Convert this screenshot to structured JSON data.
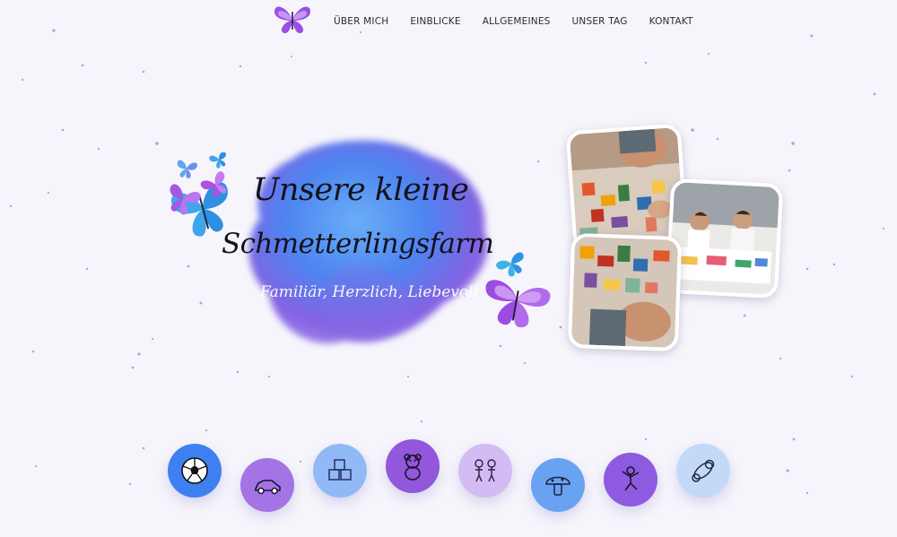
{
  "nav": {
    "logo_icon": "butterfly-logo-icon",
    "links": [
      {
        "label": "ÜBER MICH"
      },
      {
        "label": "EINBLICKE"
      },
      {
        "label": "ALLGEMEINES"
      },
      {
        "label": "UNSER TAG"
      },
      {
        "label": "KONTAKT"
      }
    ]
  },
  "hero": {
    "title_line1": "Unsere kleine",
    "title_line2": "Schmetterlingsfarm",
    "tagline": "Familiär, Herzlich, Liebevoll"
  },
  "photos": [
    {
      "icon": "children-playing-blocks-photo"
    },
    {
      "icon": "two-boys-at-table-photo"
    },
    {
      "icon": "building-blocks-photo"
    }
  ],
  "feature_circles": [
    {
      "icon": "soccer-ball-icon",
      "color": "#3f80f0"
    },
    {
      "icon": "toy-car-icon",
      "color": "#a474e6"
    },
    {
      "icon": "toy-blocks-icon",
      "color": "#90b9f6"
    },
    {
      "icon": "teddy-bear-icon",
      "color": "#9257da"
    },
    {
      "icon": "children-drawing-icon",
      "color": "#d2bcf3"
    },
    {
      "icon": "mushroom-icon",
      "color": "#6aa2f2"
    },
    {
      "icon": "jumping-child-icon",
      "color": "#8e5adf"
    },
    {
      "icon": "pacifier-icon",
      "color": "#c2daf8"
    }
  ],
  "colors": {
    "background": "#f6f5fb",
    "watercolor_blue": "#3e7bf0",
    "watercolor_purple": "#7f4cdc",
    "butterfly_purple": "#9b4de0",
    "butterfly_blue": "#3fb0e8"
  }
}
